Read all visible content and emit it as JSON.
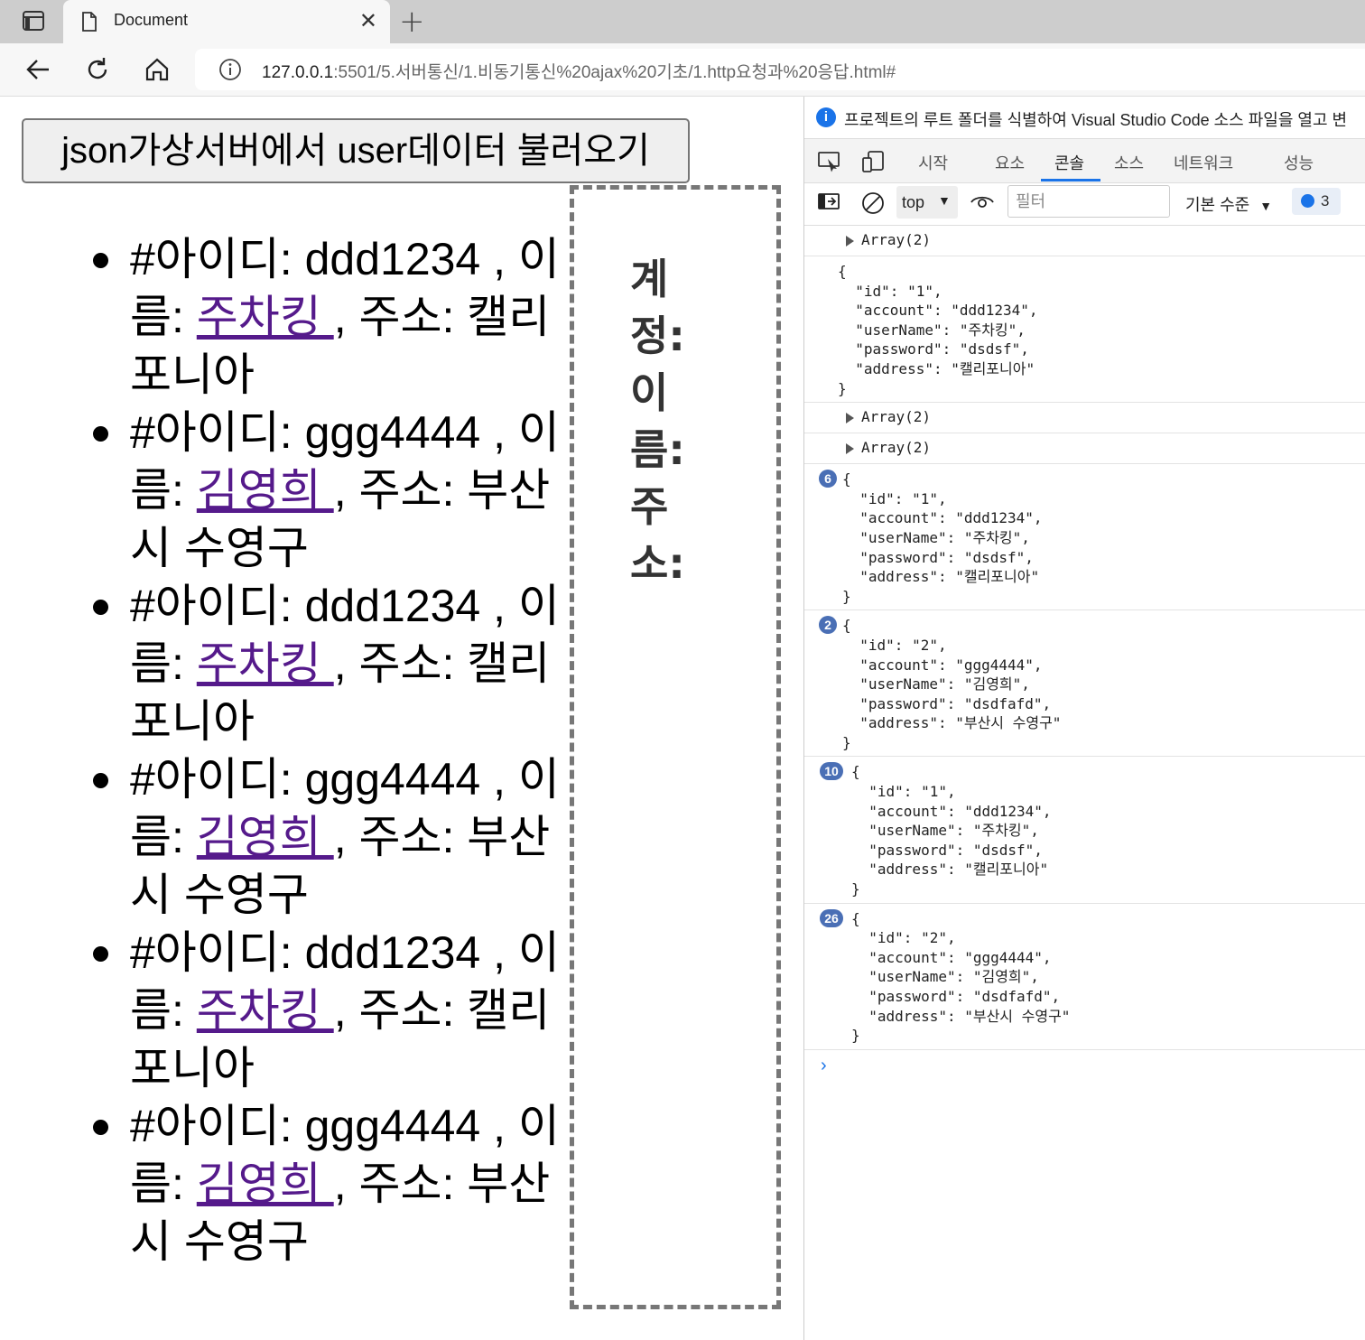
{
  "browser": {
    "tab_title": "Document",
    "url_host": "127.0.0.1",
    "url_rest": ":5501/5.서버통신/1.비동기통신%20ajax%20기초/1.http요청과%20응답.html#"
  },
  "page": {
    "load_button_label": "json가상서버에서 user데이터 불러오기",
    "users": [
      {
        "pre": "#아이디: ddd1234 , 이름: ",
        "name": "주차킹 ",
        "post": ", 주소: 캘리포니아"
      },
      {
        "pre": "#아이디: ggg4444 , 이름: ",
        "name": "김영희 ",
        "post": ", 주소: 부산시 수영구"
      },
      {
        "pre": "#아이디: ddd1234 , 이름: ",
        "name": "주차킹 ",
        "post": ", 주소: 캘리포니아"
      },
      {
        "pre": "#아이디: ggg4444 , 이름: ",
        "name": "김영희 ",
        "post": ", 주소: 부산시 수영구"
      },
      {
        "pre": "#아이디: ddd1234 , 이름: ",
        "name": "주차킹 ",
        "post": ", 주소: 캘리포니아"
      },
      {
        "pre": "#아이디: ggg4444 , 이름: ",
        "name": "김영희 ",
        "post": ", 주소: 부산시 수영구"
      }
    ],
    "info_labels": [
      "계정:",
      "이름:",
      "주소:"
    ]
  },
  "devtools": {
    "info_message": "프로젝트의 루트 폴더를 식별하여 Visual Studio Code 소스 파일을 열고 변",
    "tabs": [
      "시작",
      "요소",
      "콘솔",
      "소스",
      "네트워크",
      "성능"
    ],
    "active_tab": "콘솔",
    "context": "top",
    "filter_placeholder": "필터",
    "levels_label": "기본 수준",
    "message_count": "3",
    "console": [
      {
        "type": "array",
        "label": "Array(2)"
      },
      {
        "type": "object",
        "badge": "",
        "text": "{\n  \"id\": \"1\",\n  \"account\": \"ddd1234\",\n  \"userName\": \"주차킹\",\n  \"password\": \"dsdsf\",\n  \"address\": \"캘리포니아\"\n}"
      },
      {
        "type": "array",
        "label": "Array(2)"
      },
      {
        "type": "array",
        "label": "Array(2)"
      },
      {
        "type": "object",
        "badge": "6",
        "text": "{\n  \"id\": \"1\",\n  \"account\": \"ddd1234\",\n  \"userName\": \"주차킹\",\n  \"password\": \"dsdsf\",\n  \"address\": \"캘리포니아\"\n}"
      },
      {
        "type": "object",
        "badge": "2",
        "text": "{\n  \"id\": \"2\",\n  \"account\": \"ggg4444\",\n  \"userName\": \"김영희\",\n  \"password\": \"dsdfafd\",\n  \"address\": \"부산시 수영구\"\n}"
      },
      {
        "type": "object",
        "badge": "10",
        "text": "{\n  \"id\": \"1\",\n  \"account\": \"ddd1234\",\n  \"userName\": \"주차킹\",\n  \"password\": \"dsdsf\",\n  \"address\": \"캘리포니아\"\n}"
      },
      {
        "type": "object",
        "badge": "26",
        "text": "{\n  \"id\": \"2\",\n  \"account\": \"ggg4444\",\n  \"userName\": \"김영희\",\n  \"password\": \"dsdfafd\",\n  \"address\": \"부산시 수영구\"\n}"
      }
    ],
    "prompt_symbol": "›"
  },
  "icons": {
    "sidebar": "sidebar-toggle-icon",
    "page": "document-icon",
    "close": "close-icon",
    "newtab": "plus-icon",
    "back": "back-arrow-icon",
    "refresh": "refresh-icon",
    "home": "home-icon",
    "info": "info-icon"
  }
}
